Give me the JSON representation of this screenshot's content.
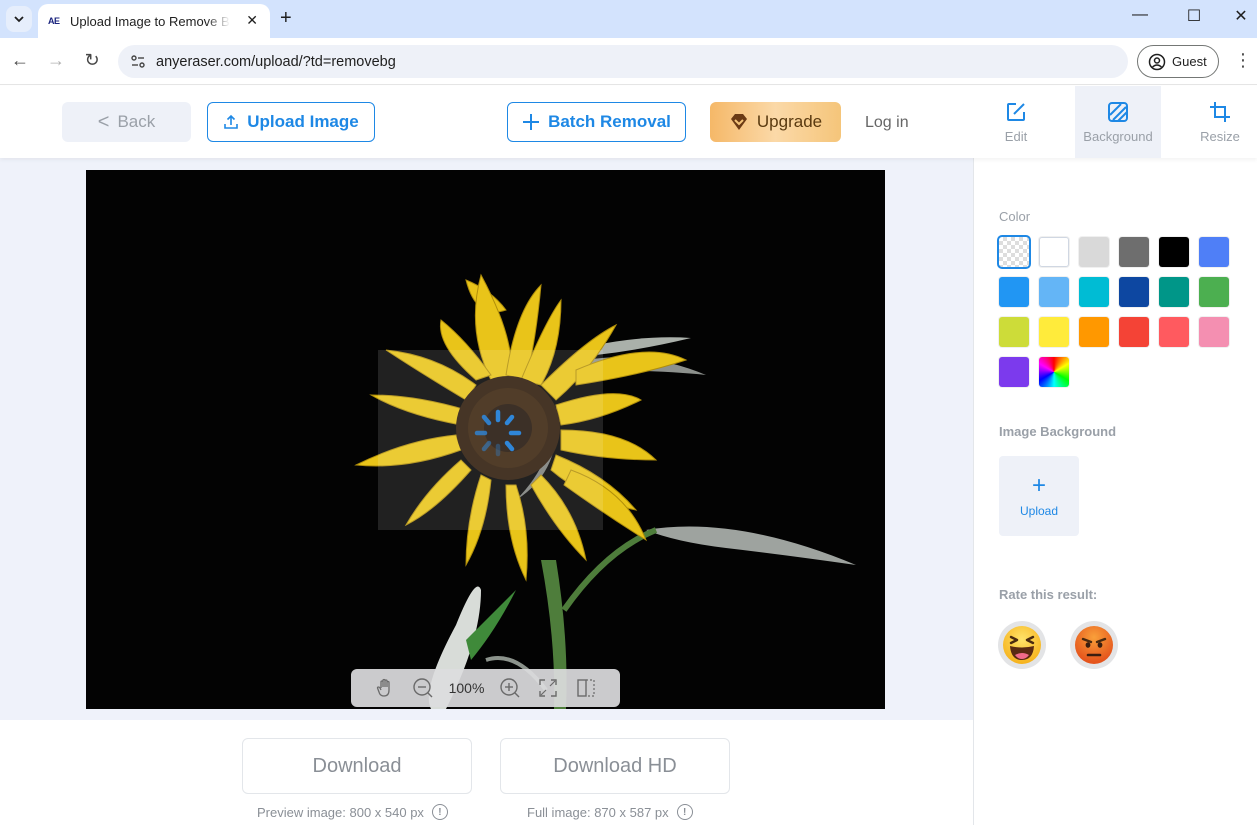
{
  "browser": {
    "tab_title": "Upload Image to Remove Bg",
    "tab_favicon": "AE",
    "url": "anyeraser.com/upload/?td=removebg",
    "profile_label": "Guest",
    "icons": {
      "tab_dropdown": "chevron-down-icon",
      "tab_close": "close-icon",
      "new_tab": "plus-icon",
      "minimize": "minimize-icon",
      "maximize": "maximize-icon",
      "close_window": "close-icon",
      "back": "arrow-left-icon",
      "forward": "arrow-right-icon",
      "reload": "reload-icon",
      "site_info": "tune-icon",
      "profile": "account-circle-icon",
      "menu": "more-vertical-icon"
    },
    "glyphs": {
      "close": "✕",
      "plus": "+",
      "minimize": "—",
      "maximize": "☐",
      "back": "←",
      "forward": "→",
      "reload": "↻",
      "menu": "⋮"
    }
  },
  "header": {
    "back_label": "Back",
    "back_glyph": "<",
    "upload_label": "Upload Image",
    "batch_label": "Batch Removal",
    "upgrade_label": "Upgrade",
    "login_label": "Log in",
    "side_tabs": [
      {
        "label": "Edit",
        "icon": "edit-icon",
        "active": false
      },
      {
        "label": "Background",
        "icon": "background-icon",
        "active": true
      },
      {
        "label": "Resize",
        "icon": "crop-icon",
        "active": false
      }
    ]
  },
  "canvas": {
    "image_subject": "sunflower on black background",
    "loading": true,
    "zoom_level": "100%",
    "zoom_tools": [
      "hand-icon",
      "zoom-out-icon",
      "zoom-in-icon",
      "fit-screen-icon",
      "compare-icon"
    ]
  },
  "downloads": {
    "download_label": "Download",
    "download_hd_label": "Download HD",
    "preview_note": "Preview image: 800 x 540 px",
    "full_note": "Full image: 870 x 587 px",
    "info_glyph": "!"
  },
  "sidebar": {
    "color_label": "Color",
    "colors": [
      {
        "name": "transparent",
        "hex": "transparent",
        "selected": true
      },
      {
        "name": "white",
        "hex": "#ffffff"
      },
      {
        "name": "light-gray",
        "hex": "#d9d9d9"
      },
      {
        "name": "gray",
        "hex": "#6e6e6e"
      },
      {
        "name": "black",
        "hex": "#000000"
      },
      {
        "name": "blue",
        "hex": "#4f7ff7"
      },
      {
        "name": "sky-blue",
        "hex": "#2196f3"
      },
      {
        "name": "light-blue",
        "hex": "#64b5f6"
      },
      {
        "name": "cyan",
        "hex": "#00bcd4"
      },
      {
        "name": "navy",
        "hex": "#0d47a1"
      },
      {
        "name": "teal",
        "hex": "#009688"
      },
      {
        "name": "green",
        "hex": "#4caf50"
      },
      {
        "name": "lime",
        "hex": "#cddc39"
      },
      {
        "name": "yellow",
        "hex": "#ffeb3b"
      },
      {
        "name": "orange",
        "hex": "#ff9800"
      },
      {
        "name": "red",
        "hex": "#f44336"
      },
      {
        "name": "coral",
        "hex": "#ff5a5f"
      },
      {
        "name": "pink",
        "hex": "#f48fb1"
      },
      {
        "name": "purple",
        "hex": "#7c3aed"
      },
      {
        "name": "custom-color",
        "hex": "rainbow"
      }
    ],
    "image_bg_label": "Image Background",
    "upload_label": "Upload",
    "rate_label": "Rate this result:",
    "ratings": [
      {
        "name": "laughing-emoji-icon",
        "label": "good"
      },
      {
        "name": "angry-emoji-icon",
        "label": "bad"
      }
    ]
  },
  "theme": {
    "accent": "#1e88e5",
    "canvas_bg": "#eff2fa",
    "muted_text": "#9aa0a8"
  }
}
